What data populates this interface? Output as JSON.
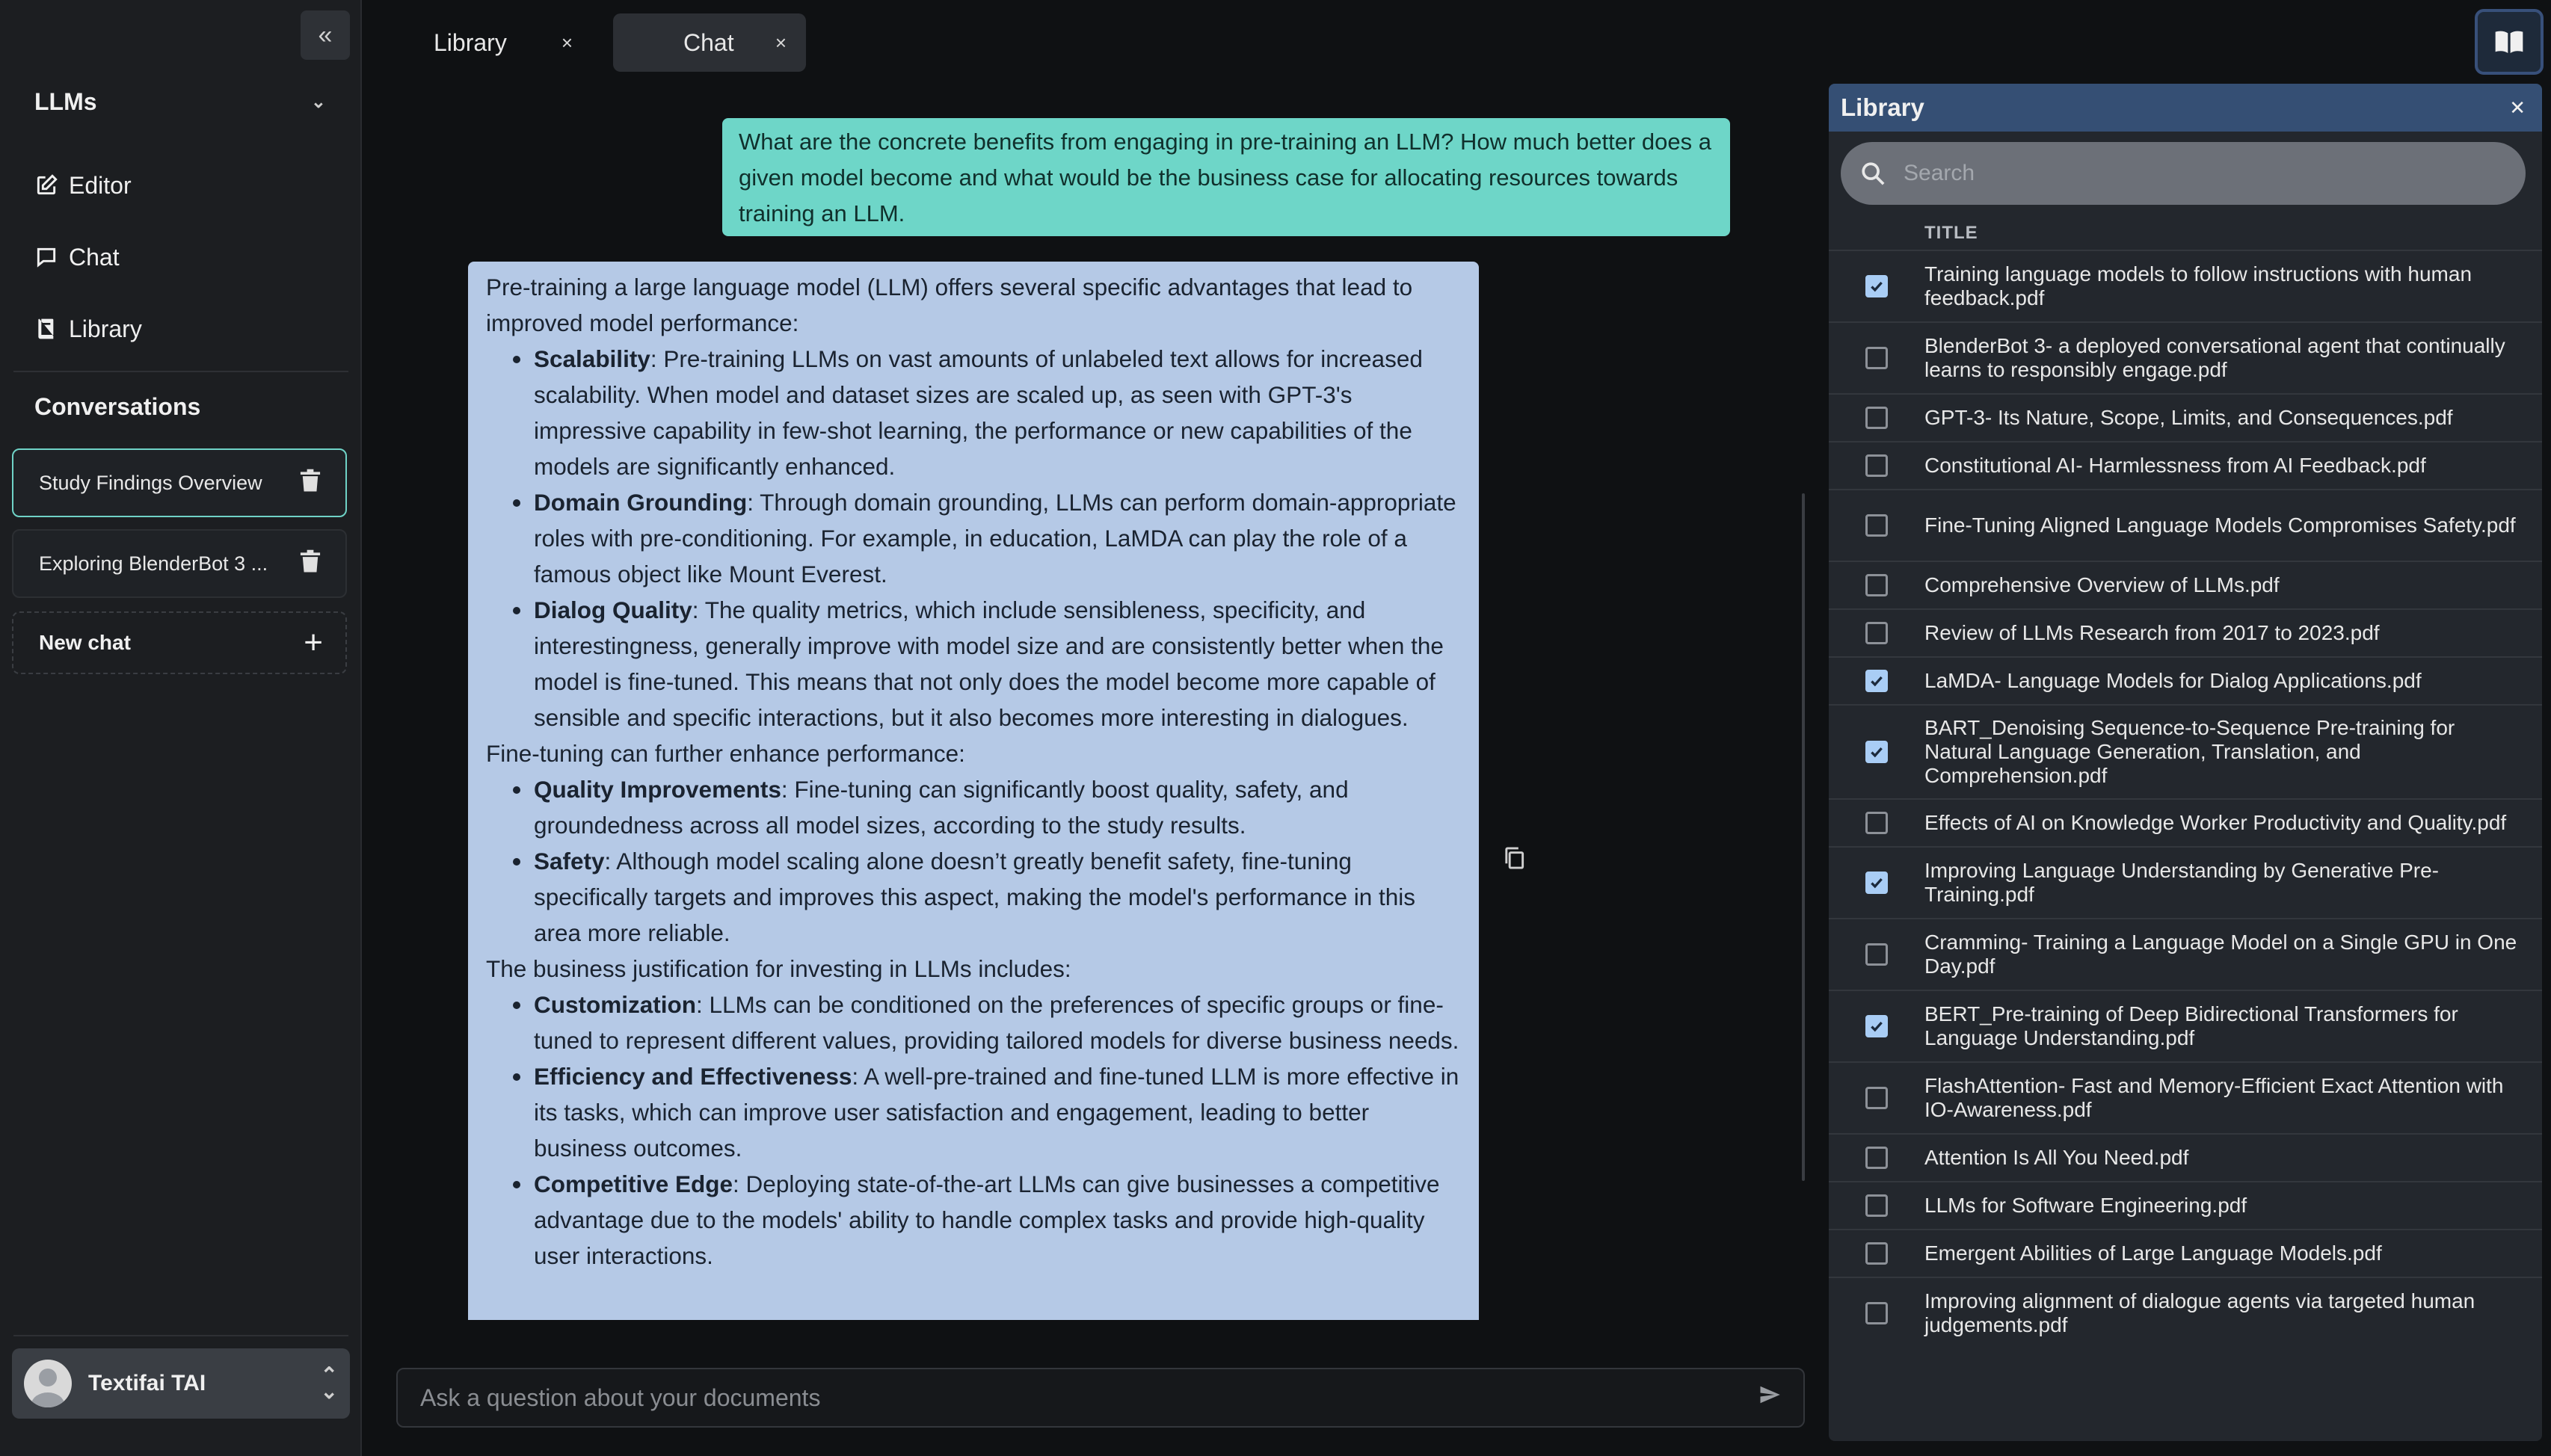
{
  "sidebar": {
    "workspace": "LLMs",
    "nav": [
      {
        "label": "Editor"
      },
      {
        "label": "Chat"
      },
      {
        "label": "Library"
      }
    ],
    "conversations_title": "Conversations",
    "conversations": [
      {
        "label": "Study Findings Overview"
      },
      {
        "label": "Exploring BlenderBot 3 ..."
      }
    ],
    "new_chat": "New chat",
    "user": "Textifai TAI"
  },
  "tabs": [
    {
      "label": "Library"
    },
    {
      "label": "Chat"
    }
  ],
  "chat": {
    "question": "What are the concrete benefits from engaging in pre-training an LLM? How much better does a given model become and what would be the business case for allocating resources towards training an LLM.",
    "answer": {
      "intro": "Pre-training a large language model (LLM) offers several specific advantages that lead to improved model performance:",
      "points1": [
        {
          "term": "Scalability",
          "text": ": Pre-training LLMs on vast amounts of unlabeled text allows for increased scalability. When model and dataset sizes are scaled up, as seen with GPT-3's impressive capability in few-shot learning, the performance or new capabilities of the models are significantly enhanced."
        },
        {
          "term": "Domain Grounding",
          "text": ": Through domain grounding, LLMs can perform domain-appropriate roles with pre-conditioning. For example, in education, LaMDA can play the role of a famous object like Mount Everest."
        },
        {
          "term": "Dialog Quality",
          "text": ": The quality metrics, which include sensibleness, specificity, and interestingness, generally improve with model size and are consistently better when the model is fine-tuned. This means that not only does the model become more capable of sensible and specific interactions, but it also becomes more interesting in dialogues."
        }
      ],
      "mid": "Fine-tuning can further enhance performance:",
      "points2": [
        {
          "term": "Quality Improvements",
          "text": ": Fine-tuning can significantly boost quality, safety, and groundedness across all model sizes, according to the study results."
        },
        {
          "term": "Safety",
          "text": ": Although model scaling alone doesn’t greatly benefit safety, fine-tuning specifically targets and improves this aspect, making the model's performance in this area more reliable."
        }
      ],
      "biz": "The business justification for investing in LLMs includes:",
      "points3": [
        {
          "term": "Customization",
          "text": ": LLMs can be conditioned on the preferences of specific groups or fine-tuned to represent different values, providing tailored models for diverse business needs."
        },
        {
          "term": "Efficiency and Effectiveness",
          "text": ": A well-pre-trained and fine-tuned LLM is more effective in its tasks, which can improve user satisfaction and engagement, leading to better business outcomes."
        },
        {
          "term": "Competitive Edge",
          "text": ": Deploying state-of-the-art LLMs can give businesses a competitive advantage due to the models' ability to handle complex tasks and provide high-quality user interactions."
        }
      ]
    },
    "input_placeholder": "Ask a question about your documents"
  },
  "library": {
    "title": "Library",
    "search_placeholder": "Search",
    "column": "TITLE",
    "items": [
      {
        "title": "Training language models to follow instructions with human feedback.pdf",
        "checked": true
      },
      {
        "title": "BlenderBot 3- a deployed conversational agent that continually learns to responsibly engage.pdf",
        "checked": false
      },
      {
        "title": "GPT-3- Its Nature, Scope, Limits, and Consequences.pdf",
        "checked": false
      },
      {
        "title": "Constitutional AI- Harmlessness from AI Feedback.pdf",
        "checked": false
      },
      {
        "title": "Fine-Tuning Aligned Language Models Compromises Safety.pdf",
        "checked": false
      },
      {
        "title": "Comprehensive Overview of LLMs.pdf",
        "checked": false
      },
      {
        "title": "Review of LLMs Research from 2017 to 2023.pdf",
        "checked": false
      },
      {
        "title": "LaMDA- Language Models for Dialog Applications.pdf",
        "checked": true
      },
      {
        "title": "BART_Denoising Sequence-to-Sequence Pre-training for Natural Language Generation, Translation, and Comprehension.pdf",
        "checked": true
      },
      {
        "title": "Effects of AI on Knowledge Worker Productivity and Quality.pdf",
        "checked": false
      },
      {
        "title": "Improving Language Understanding by Generative Pre-Training.pdf",
        "checked": true
      },
      {
        "title": "Cramming- Training a Language Model on a Single GPU in One Day.pdf",
        "checked": false
      },
      {
        "title": "BERT_Pre-training of Deep Bidirectional Transformers for Language Understanding.pdf",
        "checked": true
      },
      {
        "title": "FlashAttention- Fast and Memory-Efficient Exact Attention with IO-Awareness.pdf",
        "checked": false
      },
      {
        "title": "Attention Is All You Need.pdf",
        "checked": false
      },
      {
        "title": "LLMs for Software Engineering.pdf",
        "checked": false
      },
      {
        "title": "Emergent Abilities of Large Language Models.pdf",
        "checked": false
      },
      {
        "title": "Improving alignment of dialogue agents via targeted human judgements.pdf",
        "checked": false
      }
    ]
  }
}
